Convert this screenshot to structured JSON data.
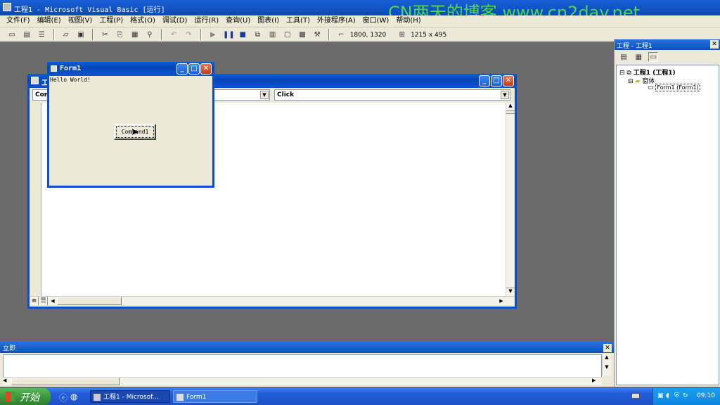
{
  "app": {
    "title": "工程1 - Microsoft Visual Basic [运行]",
    "watermark": "CN两天的博客 www.cn2day.net"
  },
  "menu": [
    "文件(F)",
    "编辑(E)",
    "视图(V)",
    "工程(P)",
    "格式(O)",
    "调试(D)",
    "运行(R)",
    "查询(U)",
    "图表(I)",
    "工具(T)",
    "外接程序(A)",
    "窗口(W)",
    "帮助(H)"
  ],
  "toolbar": {
    "position": "1800, 1320",
    "size": "1215 x 495"
  },
  "code_window": {
    "title": "工",
    "object_combo": "Com",
    "proc_combo": "Click"
  },
  "form1": {
    "title": "Form1",
    "label": "Hello World!",
    "button": "Command1"
  },
  "project_panel": {
    "title": "工程 - 工程1",
    "root": "工程1 (工程1)",
    "folder": "窗体",
    "item": "Form1 (Form1)"
  },
  "immediate": {
    "title": "立即"
  },
  "taskbar": {
    "start": "开始",
    "tasks": [
      "工程1 - Microsof...",
      "Form1"
    ],
    "clock": "09:10"
  },
  "colors": {
    "xp_blue": "#0a5fd8",
    "taskbar": "#245edb",
    "start_green": "#3c9a3c",
    "watermark": "#52d452"
  }
}
